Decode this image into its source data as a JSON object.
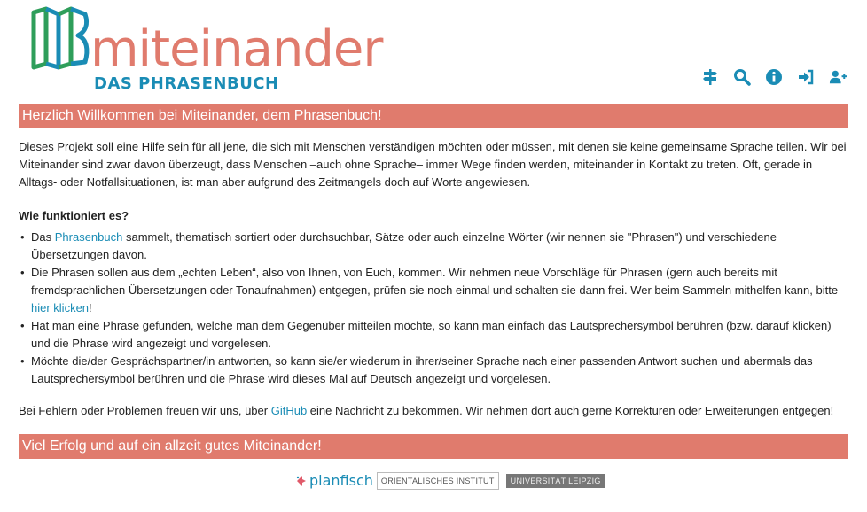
{
  "logo": {
    "word": "miteinander",
    "subtitle": "DAS PHRASENBUCH"
  },
  "nav": [
    {
      "name": "signpost-icon",
      "label": "Kategorien"
    },
    {
      "name": "search-icon",
      "label": "Suche"
    },
    {
      "name": "info-icon",
      "label": "Info"
    },
    {
      "name": "login-icon",
      "label": "Anmelden"
    },
    {
      "name": "user-plus-icon",
      "label": "Registrieren"
    }
  ],
  "colors": {
    "accent": "#e07b6d",
    "brand": "#1a8cb5",
    "logo_green": "#2e9e5a"
  },
  "banner_top": "Herzlich Willkommen bei Miteinander, dem Phrasenbuch!",
  "intro": "Dieses Projekt soll eine Hilfe sein für all jene, die sich mit Menschen verständigen möchten oder müssen, mit denen sie keine gemeinsame Sprache teilen. Wir bei Miteinander sind zwar davon überzeugt, dass Menschen –auch ohne Sprache– immer Wege finden werden, miteinander in Kontakt zu treten. Oft, gerade in Alltags- oder Notfallsituationen, ist man aber aufgrund des Zeitmangels doch auf Worte angewiesen.",
  "how_heading": "Wie funktioniert es?",
  "bullets": {
    "b1_pre": "Das ",
    "b1_link": "Phrasenbuch",
    "b1_post": " sammelt, thematisch sortiert oder durchsuchbar, Sätze oder auch einzelne Wörter (wir nennen sie \"Phrasen\") und verschiedene Übersetzungen davon.",
    "b2_pre": "Die Phrasen sollen aus dem „echten Leben“, also von Ihnen, von Euch, kommen. Wir nehmen neue Vorschläge für Phrasen (gern auch bereits mit fremdsprachlichen Übersetzungen oder Tonaufnahmen) entgegen, prüfen sie noch einmal und schalten sie dann frei. Wer beim Sammeln mithelfen kann, bitte ",
    "b2_link": "hier klicken",
    "b2_post": "!",
    "b3": "Hat man eine Phrase gefunden, welche man dem Gegenüber mitteilen möchte, so kann man einfach das Lautsprechersymbol berühren (bzw. darauf klicken) und die Phrase wird angezeigt und vorgelesen.",
    "b4": "Möchte die/der Gesprächspartner/in antworten, so kann sie/er wiederum in ihrer/seiner Sprache nach einer passenden Antwort suchen und abermals das Lautsprechersymbol berühren und die Phrase wird dieses Mal auf Deutsch angezeigt und vorgelesen."
  },
  "errors": {
    "pre": "Bei Fehlern oder Problemen freuen wir uns, über ",
    "link": "GitHub",
    "post": " eine Nachricht zu bekommen. Wir nehmen dort auch gerne Korrekturen oder Erweiterungen entgegen!"
  },
  "banner_bottom": "Viel Erfolg und auf ein allzeit gutes Miteinander!",
  "footer": {
    "planfisch": "planfisch",
    "orient": "ORIENTALISCHES INSTITUT",
    "uni": "UNIVERSITÄT LEIPZIG"
  }
}
